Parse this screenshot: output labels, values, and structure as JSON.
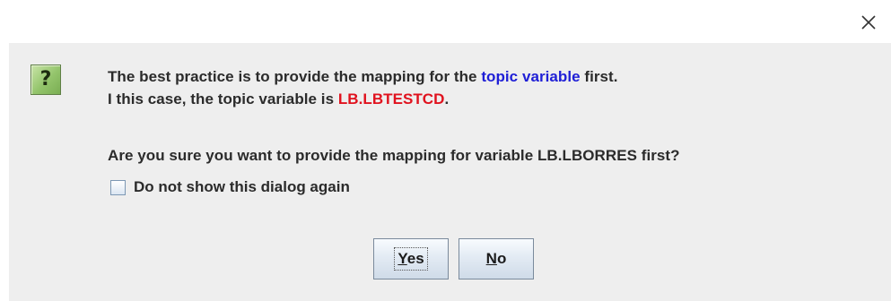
{
  "window": {
    "close_icon": "close-icon"
  },
  "dialog": {
    "icon": "question-icon",
    "icon_glyph": "?",
    "line1_prefix": "The best practice is to provide the mapping for the ",
    "line1_highlight": "topic variable",
    "line1_suffix": " first.",
    "line2_prefix": "I this case, the topic variable is ",
    "line2_highlight": "LB.LBTESTCD",
    "line2_suffix": ".",
    "line3": "Are you sure you want to provide the mapping for variable LB.LBORRES first?",
    "checkbox_label": "Do not show this dialog again",
    "checkbox_checked": false
  },
  "buttons": {
    "yes_mnemonic": "Y",
    "yes_rest": "es",
    "no_mnemonic": "N",
    "no_rest": "o"
  },
  "colors": {
    "highlight_blue": "#1f1fd6",
    "highlight_red": "#e0121e",
    "dialog_bg": "#eeeeee"
  }
}
